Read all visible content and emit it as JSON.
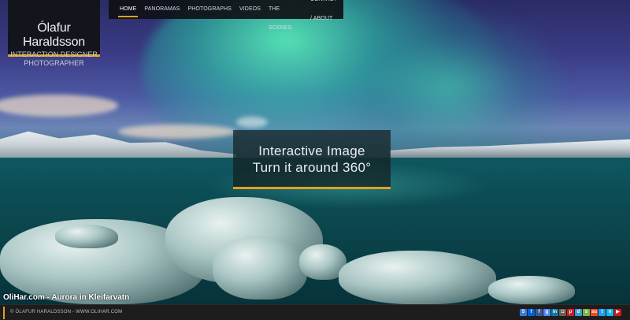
{
  "brand": {
    "name": "Ólafur Haraldsson",
    "line1": "INTERACTION DESIGNER",
    "line2": "PHOTOGRAPHER",
    "accent": "#e0a21e"
  },
  "nav": {
    "items": [
      {
        "label": "HOME",
        "active": true
      },
      {
        "label": "PANORAMAS",
        "active": false
      },
      {
        "label": "PHOTOGRAPHS",
        "active": false
      },
      {
        "label": "VIDEOS",
        "active": false
      },
      {
        "label": "BEHIND THE SCENES",
        "active": false
      },
      {
        "label": "CONTACT / ABOUT",
        "active": false
      }
    ]
  },
  "hero": {
    "line1": "Interactive Image",
    "line2": "Turn it around 360°",
    "caption": "OliHar.com - Aurora in Kleifarvatn"
  },
  "footer": {
    "copyright": "© ÓLAFUR HARALDSSON - WWW.OLIHAR.COM",
    "social_icons": [
      {
        "name": "500px-icon",
        "color": "#3a7bd5",
        "glyph": "5"
      },
      {
        "name": "flickr-icon",
        "color": "#0063dc",
        "glyph": "f"
      },
      {
        "name": "facebook-icon",
        "color": "#3b5998",
        "glyph": "f"
      },
      {
        "name": "googleplus-icon",
        "color": "#4a8af4",
        "glyph": "g"
      },
      {
        "name": "linkedin-icon",
        "color": "#0e76a8",
        "glyph": "in"
      },
      {
        "name": "instagram-icon",
        "color": "#6d5f4f",
        "glyph": "◘"
      },
      {
        "name": "pinterest-icon",
        "color": "#cb2027",
        "glyph": "p"
      },
      {
        "name": "dribbble-icon",
        "color": "#3d9bd6",
        "glyph": "d"
      },
      {
        "name": "smugmug-icon",
        "color": "#7ab648",
        "glyph": "s"
      },
      {
        "name": "stumbleupon-icon",
        "color": "#eb4924",
        "glyph": "su"
      },
      {
        "name": "twitter-icon",
        "color": "#1da1f2",
        "glyph": "t"
      },
      {
        "name": "vimeo-icon",
        "color": "#1ab7ea",
        "glyph": "v"
      },
      {
        "name": "youtube-icon",
        "color": "#cc181e",
        "glyph": "▶"
      }
    ]
  }
}
